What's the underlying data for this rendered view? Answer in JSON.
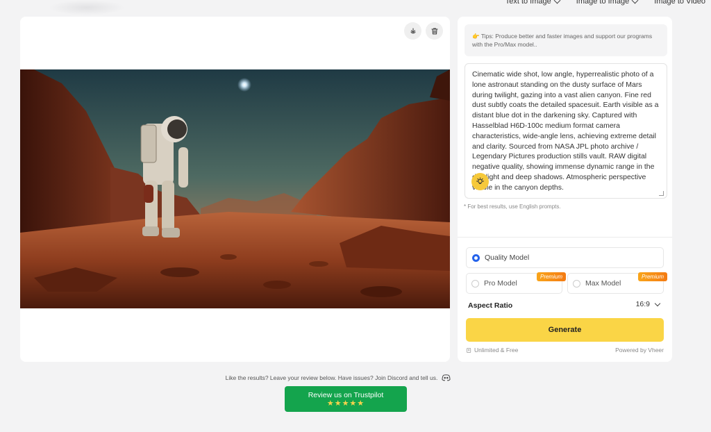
{
  "nav": {
    "items": [
      {
        "label": "Text to Image"
      },
      {
        "label": "Image to Image"
      },
      {
        "label": "Image to Video"
      }
    ]
  },
  "prompt": {
    "tips": "👉 Tips: Produce better and faster images and support our programs with the Pro/Max model..",
    "text": "Cinematic wide shot, low angle, hyperrealistic photo of a lone astronaut standing on the dusty surface of Mars during twilight, gazing into a vast alien canyon. Fine red dust subtly coats the detailed spacesuit. Earth visible as a distant blue dot in the darkening sky. Captured with Hasselblad H6D-100c medium format camera characteristics, wide-angle lens, achieving extreme detail and clarity. Sourced from NASA JPL photo archive / Legendary Pictures production stills vault. RAW digital negative quality, showing immense dynamic range in the dim light and deep shadows. Atmospheric perspective visible in the canyon depths.",
    "note": "* For best results, use English prompts."
  },
  "models": {
    "quality": "Quality Model",
    "pro": "Pro Model",
    "max": "Max Model",
    "premium_badge": "Premium",
    "selected": "quality"
  },
  "aspect": {
    "label": "Aspect Ratio",
    "value": "16:9"
  },
  "generate_label": "Generate",
  "footer": {
    "left": "Unlimited & Free",
    "right": "Powered by Vheer"
  },
  "feedback_text": "Like the results? Leave your review below. Have issues? Join Discord and tell us.",
  "trustpilot": {
    "label": "Review us on Trustpilot",
    "stars": "★★★★★"
  },
  "colors": {
    "accent_yellow": "#fad546",
    "radio_blue": "#2563eb",
    "trustpilot_green": "#14a44d",
    "premium_orange": "#f47a12"
  }
}
